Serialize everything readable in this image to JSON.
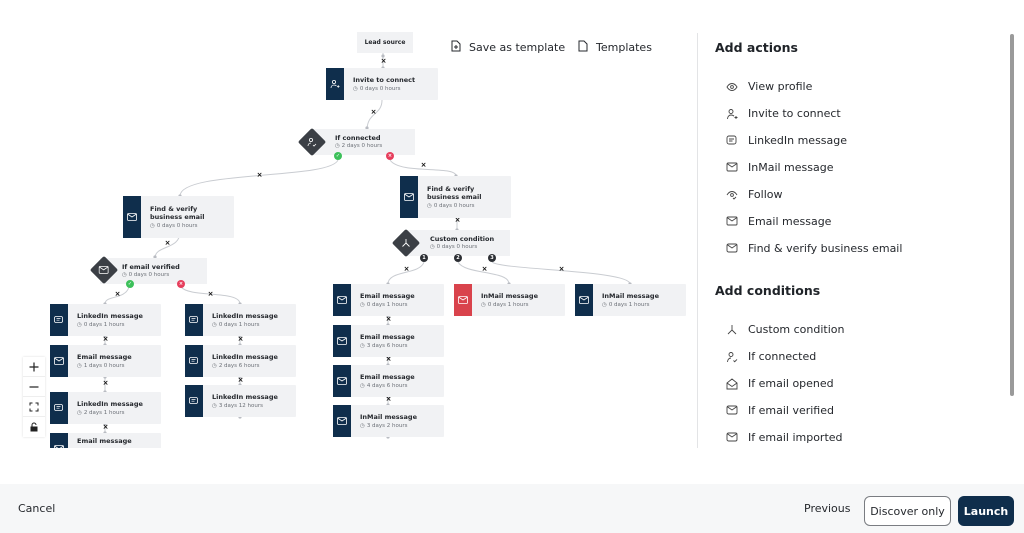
{
  "canvas": {
    "toolbar": {
      "save_template": "Save as template",
      "templates": "Templates"
    },
    "lead_source": "Lead source",
    "nodes": {
      "invite": {
        "title": "Invite to connect",
        "delay": "0 days 0 hours",
        "icon": "user-plus-icon"
      },
      "if_connected": {
        "title": "If connected",
        "delay": "2 days 0 hours",
        "icon": "user-check-icon"
      },
      "find_left": {
        "title": "Find & verify business email",
        "delay": "0 days 0 hours",
        "icon": "mail-check-icon"
      },
      "find_right": {
        "title": "Find & verify business email",
        "delay": "0 days 0 hours",
        "icon": "mail-check-icon"
      },
      "if_email_verified": {
        "title": "If email verified",
        "delay": "0 days 0 hours",
        "icon": "mail-check-icon"
      },
      "custom_condition": {
        "title": "Custom condition",
        "delay": "0 days 0 hours",
        "icon": "branch-icon"
      },
      "l_yes": [
        {
          "title": "LinkedIn message",
          "delay": "0 days 1 hours"
        },
        {
          "title": "Email message",
          "delay": "1 days 0 hours"
        },
        {
          "title": "LinkedIn message",
          "delay": "2 days 1 hours"
        },
        {
          "title": "Email message",
          "delay": ""
        }
      ],
      "l_no": [
        {
          "title": "LinkedIn message",
          "delay": "0 days 1 hours"
        },
        {
          "title": "LinkedIn message",
          "delay": "2 days 6 hours"
        },
        {
          "title": "LinkedIn message",
          "delay": "3 days 12 hours"
        }
      ],
      "branch1": [
        {
          "title": "Email message",
          "delay": "0 days 1 hours"
        },
        {
          "title": "Email message",
          "delay": "3 days 6 hours"
        },
        {
          "title": "Email message",
          "delay": "4 days 6 hours"
        },
        {
          "title": "InMail message",
          "delay": "3 days 2 hours"
        }
      ],
      "branch2": [
        {
          "title": "InMail message",
          "delay": "0 days 1 hours",
          "status": "error"
        }
      ],
      "branch3": [
        {
          "title": "InMail message",
          "delay": "0 days 1 hours"
        }
      ]
    },
    "branch_labels": [
      "1",
      "2",
      "3"
    ],
    "zoom_controls": [
      "zoom-in",
      "zoom-out",
      "fit-view",
      "lock"
    ]
  },
  "panel": {
    "actions_title": "Add actions",
    "actions": [
      {
        "label": "View profile",
        "icon": "eye-icon"
      },
      {
        "label": "Invite to connect",
        "icon": "user-plus-icon"
      },
      {
        "label": "LinkedIn message",
        "icon": "chat-icon"
      },
      {
        "label": "InMail message",
        "icon": "mail-icon"
      },
      {
        "label": "Follow",
        "icon": "eye-follow-icon"
      },
      {
        "label": "Email message",
        "icon": "mail-icon"
      },
      {
        "label": "Find & verify business email",
        "icon": "mail-check-icon"
      }
    ],
    "conditions_title": "Add conditions",
    "conditions": [
      {
        "label": "Custom condition",
        "icon": "branch-icon"
      },
      {
        "label": "If connected",
        "icon": "user-check-icon"
      },
      {
        "label": "If email opened",
        "icon": "mail-open-icon"
      },
      {
        "label": "If email verified",
        "icon": "mail-check-icon"
      },
      {
        "label": "If email imported",
        "icon": "mail-check-icon"
      }
    ]
  },
  "footer": {
    "cancel": "Cancel",
    "previous": "Previous",
    "discover_only": "Discover only",
    "launch": "Launch"
  },
  "colors": {
    "primary": "#0f2e4c",
    "error": "#d9434c",
    "yes": "#3cc05a",
    "no": "#e63e5c"
  }
}
